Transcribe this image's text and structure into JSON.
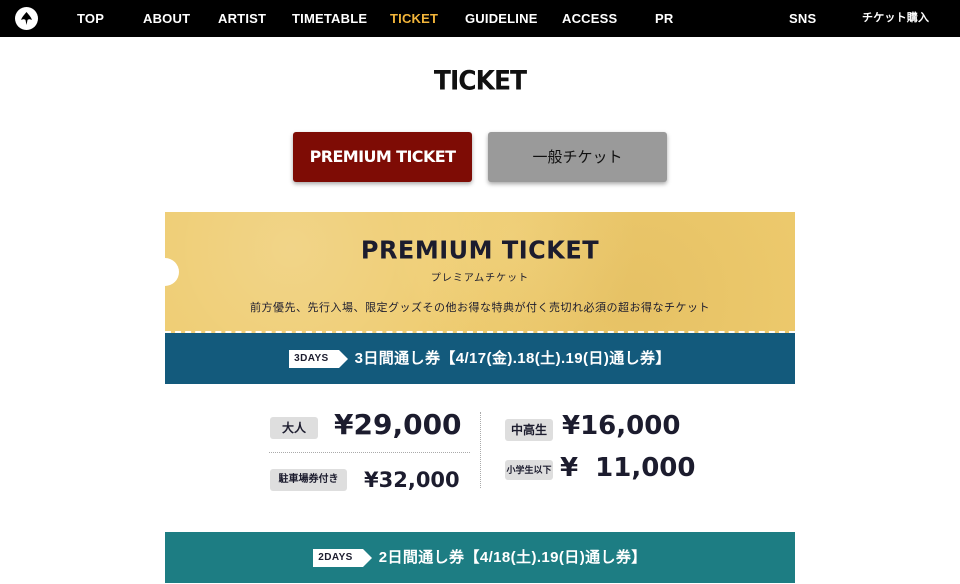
{
  "nav": {
    "logo_icon": "bird-logo-icon",
    "items": [
      {
        "label": "TOP"
      },
      {
        "label": "ABOUT"
      },
      {
        "label": "ARTIST"
      },
      {
        "label": "TIMETABLE"
      },
      {
        "label": "TICKET"
      },
      {
        "label": "GUIDELINE"
      },
      {
        "label": "ACCESS"
      },
      {
        "label": "PR"
      },
      {
        "label": "SNS"
      },
      {
        "label": "チケット購入"
      }
    ],
    "active_color": "#f2b53a"
  },
  "page": {
    "title": "TICKET"
  },
  "tabs": {
    "premium_label": "PREMIUM TICKET",
    "general_label": "一般チケット",
    "premium_color": "#7e0c05",
    "general_color": "#9a9a9a"
  },
  "premium_card": {
    "title": "PREMIUM TICKET",
    "subtitle": "プレミアムチケット",
    "description": "前方優先、先行入場、限定グッズその他お得な特典が付く売切れ必須の超お得なチケット",
    "background_color": "#eecb6e"
  },
  "plans": [
    {
      "tag": "3DAYS",
      "title": "3日間通し券【4/17(金).18(土).19(日)通し券】",
      "color": "#135a7c",
      "prices": {
        "adult": {
          "label": "大人",
          "value": "¥29,000"
        },
        "parking": {
          "label": "駐車場券付き",
          "value": "¥32,000"
        },
        "highschool": {
          "label": "中高生",
          "value": "¥16,000"
        },
        "elementary": {
          "label": "小学生以下",
          "value": "¥ 11,000"
        }
      }
    },
    {
      "tag": "2DAYS",
      "title": "2日間通し券【4/18(土).19(日)通し券】",
      "color": "#1d7d83"
    }
  ]
}
